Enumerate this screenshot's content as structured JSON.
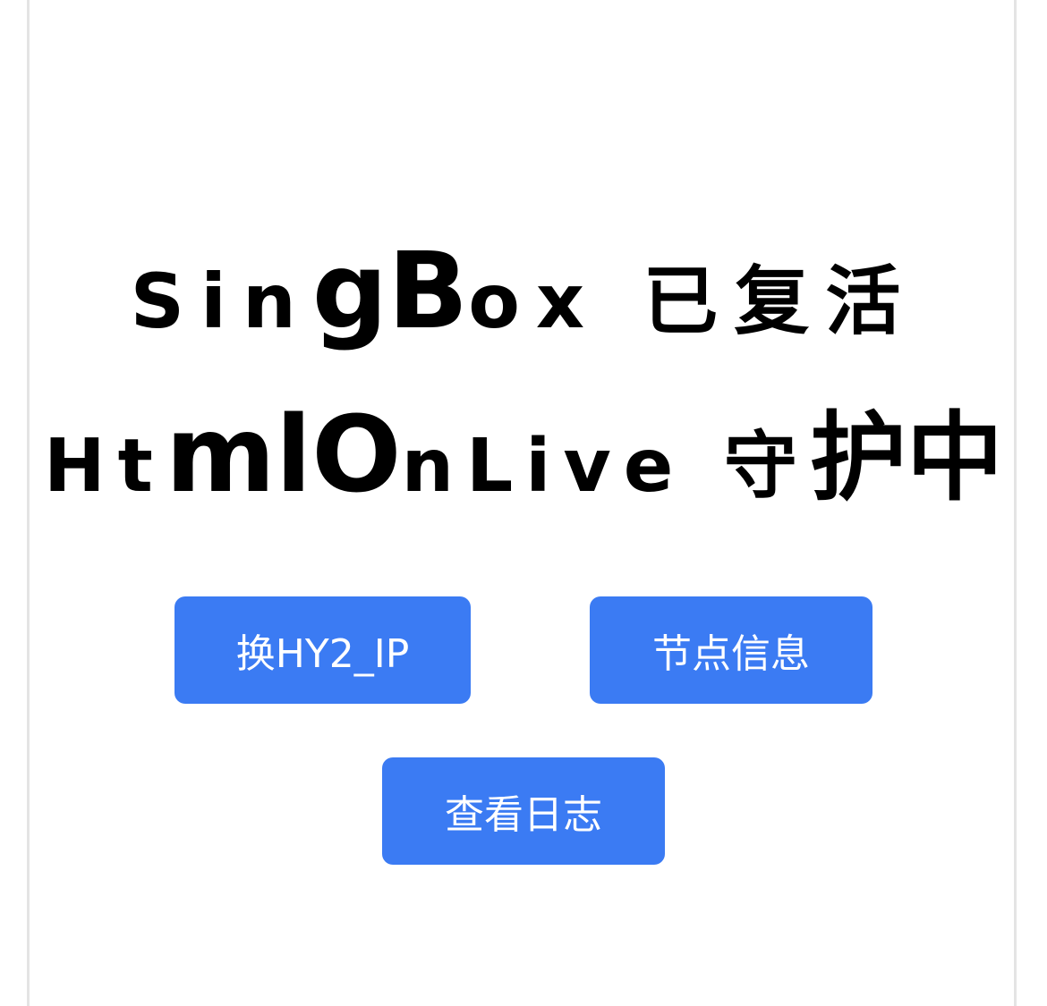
{
  "headline": {
    "line1_a": "Sin",
    "line1_b": "gB",
    "line1_c": "ox 已复活",
    "line2_a": "Ht",
    "line2_b": "mlO",
    "line2_c": "nLive 守",
    "line2_d": "护中"
  },
  "buttons": {
    "hy2_label": "换HY2_IP",
    "node_label": "节点信息",
    "log_label": "查看日志"
  },
  "colors": {
    "button_bg": "#3b7bf3",
    "button_text": "#ffffff",
    "headline": "#000000"
  }
}
